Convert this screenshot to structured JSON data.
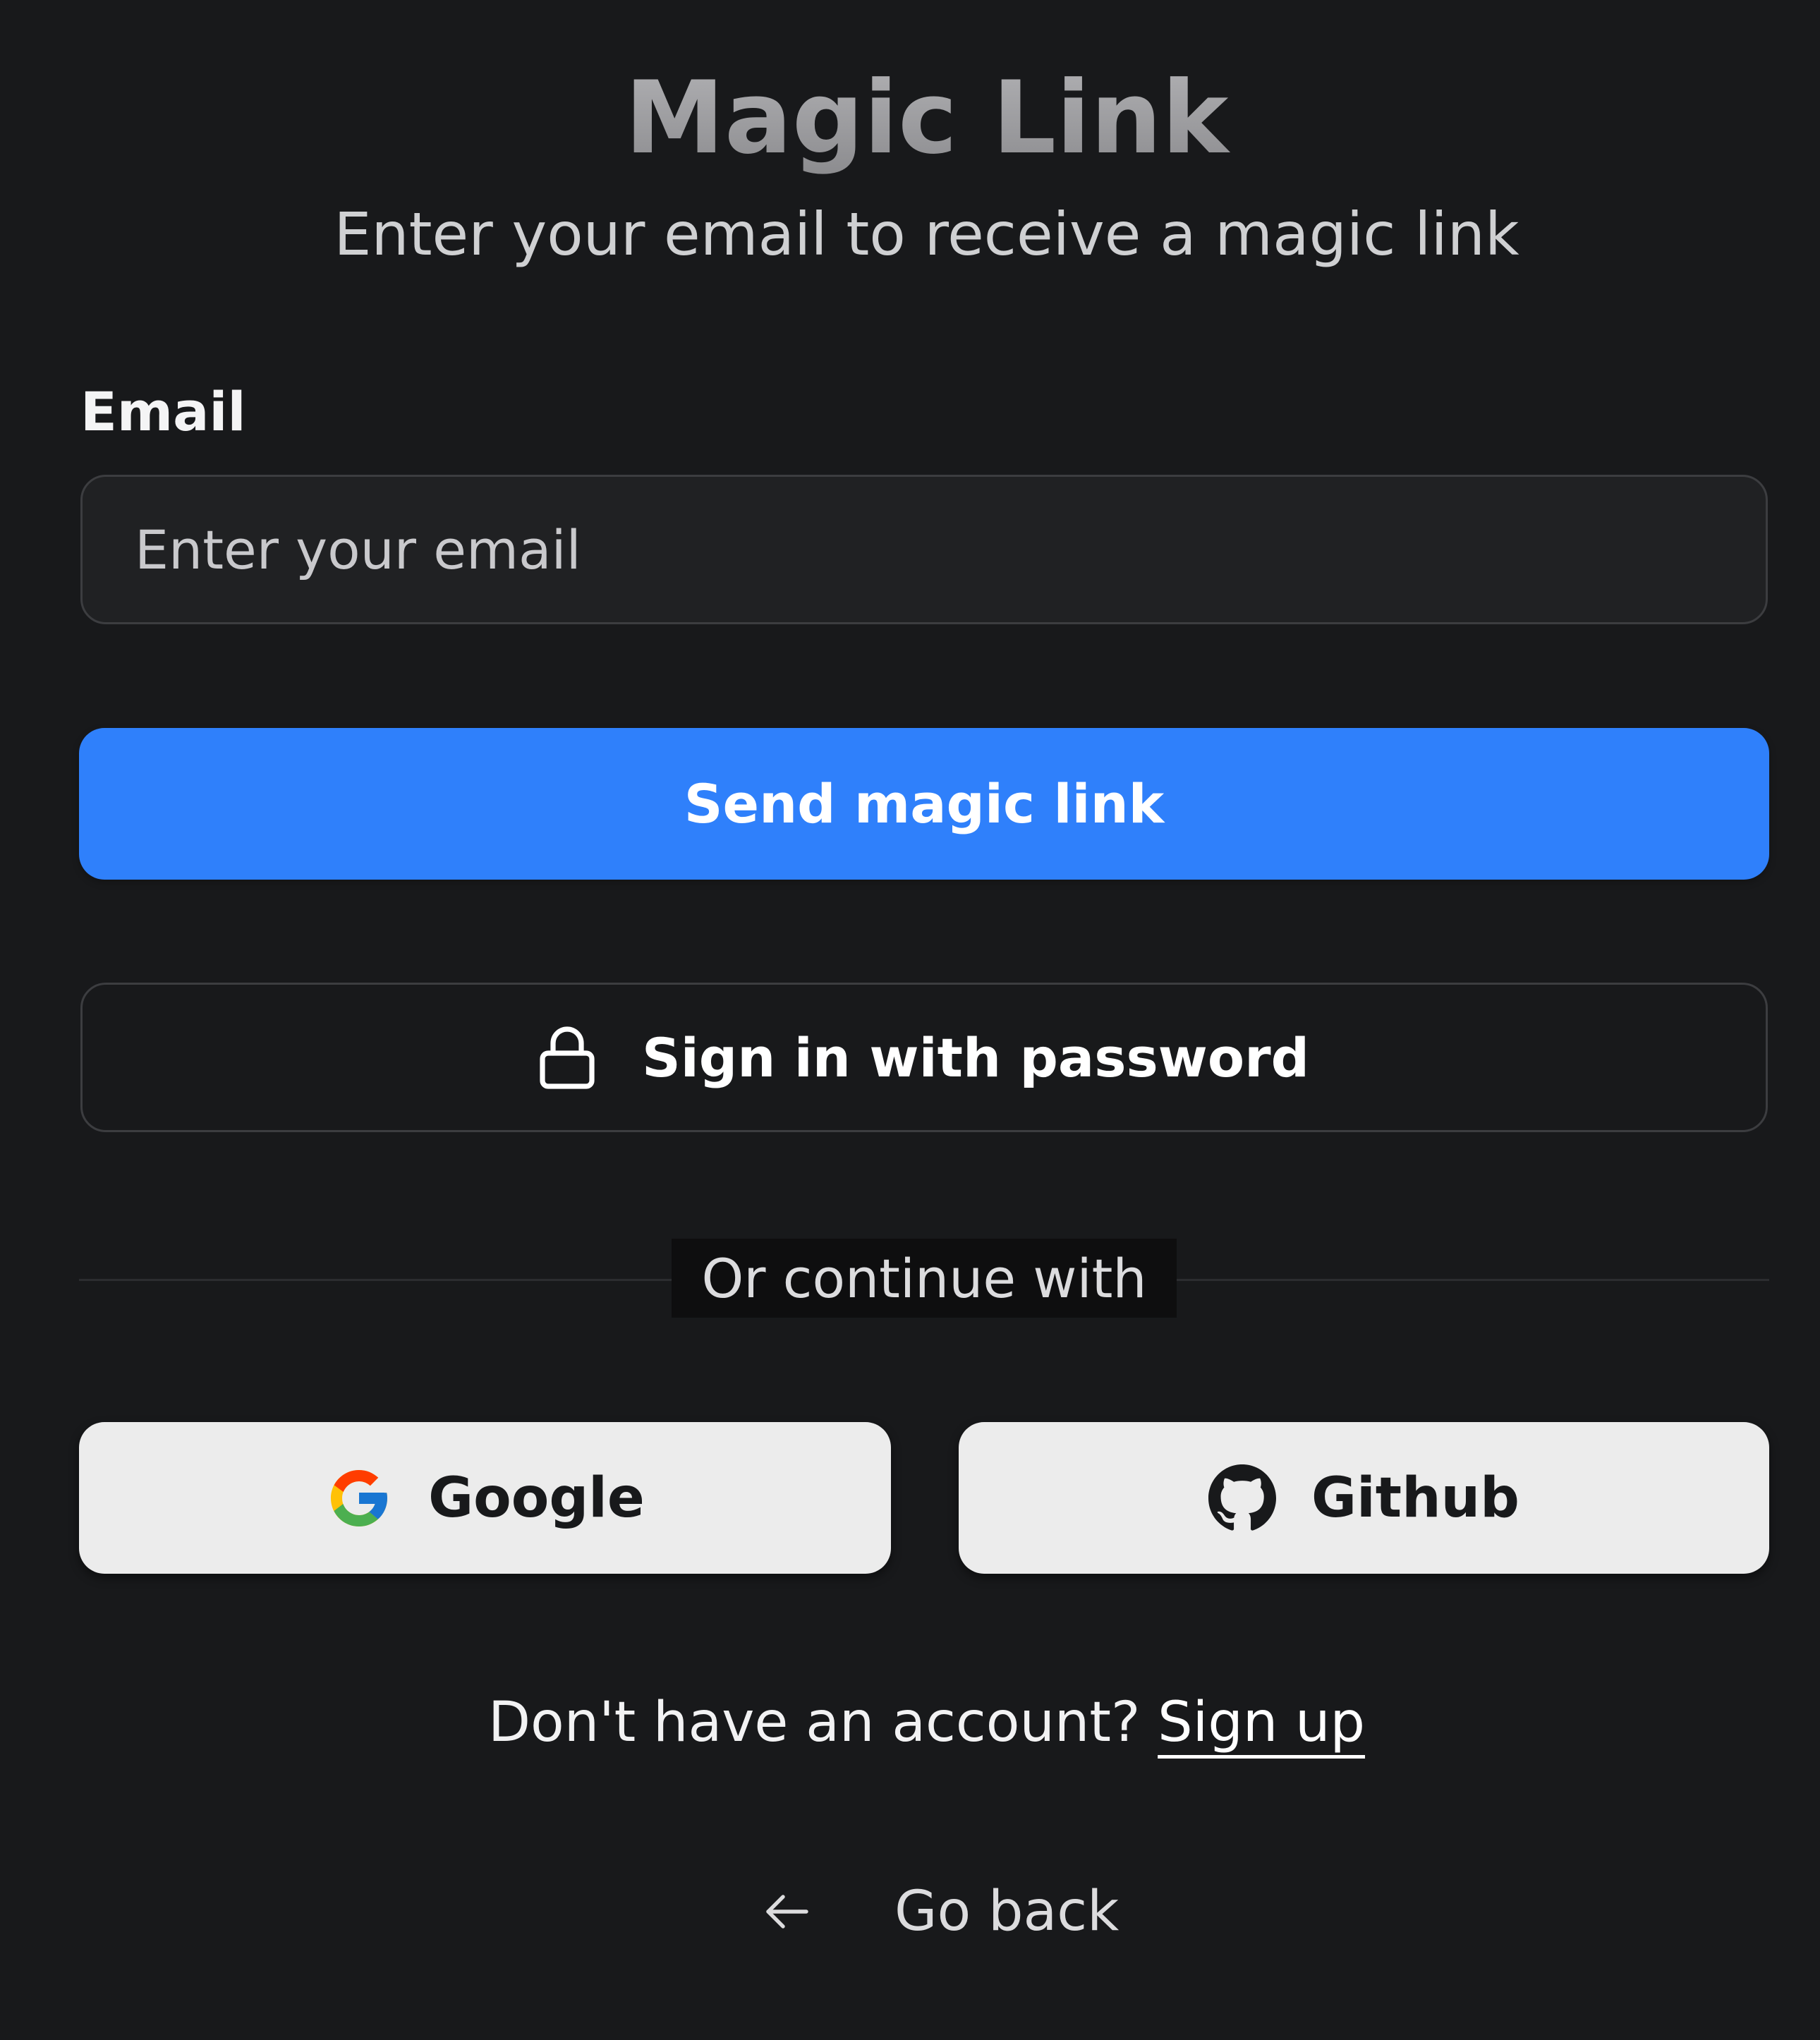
{
  "header": {
    "title": "Magic Link",
    "subtitle": "Enter your email to receive a magic link"
  },
  "form": {
    "email_label": "Email",
    "email_placeholder": "Enter your email",
    "email_value": "",
    "submit_label": "Send magic link",
    "password_signin_label": "Sign in with password",
    "password_signin_icon": "lock-icon"
  },
  "divider": {
    "text": "Or continue with"
  },
  "social": {
    "google_label": "Google",
    "google_icon": "google-icon",
    "github_label": "Github",
    "github_icon": "github-icon"
  },
  "footer": {
    "signup_prompt": "Don't have an account?",
    "signup_link": "Sign up",
    "go_back_label": "Go back",
    "go_back_icon": "arrow-left-icon"
  },
  "colors": {
    "background": "#18191b",
    "primary": "#2f80fb",
    "social_button_bg": "#ececec",
    "border": "#3c3d40"
  }
}
